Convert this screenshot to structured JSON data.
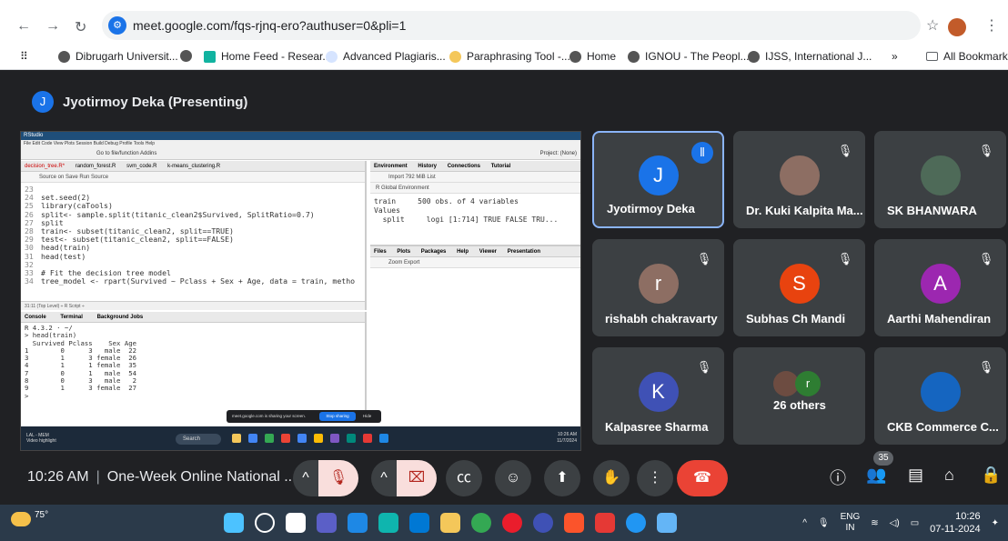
{
  "browser": {
    "url": "meet.google.com/fqs-rjnq-ero?authuser=0&pli=1",
    "bookmarks": [
      "Dibrugarh Universit...",
      "Home Feed - Resear...",
      "Advanced Plagiaris...",
      "Paraphrasing Tool -...",
      "Home",
      "IGNOU - The Peopl...",
      "IJSS, International J...",
      "All Bookmarks"
    ],
    "more": "»"
  },
  "presenter": {
    "initial": "J",
    "label": "Jyotirmoy Deka (Presenting)"
  },
  "rstudio": {
    "title": "RStudio",
    "menu": "File  Edit  Code  View  Plots  Session  Build  Debug  Profile  Tools  Help",
    "toolbar": "Go to file/function      Addins",
    "project": "Project: (None)",
    "tabs": [
      "decision_tree.R*",
      "random_forest.R",
      "svm_code.R",
      "k-means_clustering.R"
    ],
    "src_toolbar": "Source on Save          Run     Source",
    "code_lines": [
      {
        "n": "23",
        "t": ""
      },
      {
        "n": "24",
        "t": "set.seed(2)"
      },
      {
        "n": "25",
        "t": "library(caTools)"
      },
      {
        "n": "26",
        "t": "split<- sample.split(titanic_clean2$Survived, SplitRatio=0.7)"
      },
      {
        "n": "27",
        "t": "split"
      },
      {
        "n": "28",
        "t": "train<- subset(titanic_clean2, split==TRUE)"
      },
      {
        "n": "29",
        "t": "test<- subset(titanic_clean2, split==FALSE)"
      },
      {
        "n": "30",
        "t": "head(train)"
      },
      {
        "n": "31",
        "t": "head(test)"
      },
      {
        "n": "32",
        "t": ""
      },
      {
        "n": "33",
        "t": "# Fit the decision tree model"
      },
      {
        "n": "34",
        "t": "tree_model <- rpart(Survived ~ Pclass + Sex + Age, data = train, metho"
      }
    ],
    "src_status": "31:11   (Top Level) ÷                                                      R Script ÷",
    "console_tabs": [
      "Console",
      "Terminal",
      "Background Jobs"
    ],
    "console_text": "R 4.3.2 · ~/\n> head(train)\n  Survived Pclass    Sex Age\n1        0      3   male  22\n3        1      3 female  26\n4        1      1 female  35\n7        0      1   male  54\n8        0      3   male   2\n9        1      3 female  27\n>",
    "env_tabs": [
      "Environment",
      "History",
      "Connections",
      "Tutorial"
    ],
    "env_toolbar": "Import   792 MiB   List",
    "env_global": "R   Global Environment",
    "env_rows": "train     500 obs. of 4 variables\nValues\n  split     logi [1:714] TRUE FALSE TRU...",
    "files_tabs": [
      "Files",
      "Plots",
      "Packages",
      "Help",
      "Viewer",
      "Presentation"
    ],
    "files_toolbar": "Zoom   Export",
    "share_text": "meet.google.com is sharing your screen.",
    "stop_label": "Stop sharing",
    "hide_label": "Hide",
    "wt_left": "LAL - MEM\nVideo highlight",
    "wt_search": "Search",
    "wt_time": "10:26 AM\n11/7/2024"
  },
  "tiles": [
    {
      "name": "Jyotirmoy Deka",
      "initial": "J",
      "color": "#1a73e8",
      "speaking": true
    },
    {
      "name": "Dr. Kuki Kalpita Ma...",
      "photo": true,
      "muted": true
    },
    {
      "name": "SK BHANWARA",
      "photo": true,
      "muted": true
    },
    {
      "name": "rishabh chakravarty",
      "initial": "r",
      "color": "#8d6e63",
      "muted": true
    },
    {
      "name": "Subhas Ch Mandi",
      "initial": "S",
      "color": "#e8430f",
      "muted": true
    },
    {
      "name": "Aarthi Mahendiran",
      "initial": "A",
      "color": "#9c27b0",
      "muted": true
    },
    {
      "name": "Kalpasree Sharma",
      "initial": "K",
      "color": "#3f51b5",
      "muted": true
    },
    {
      "name": "26 others",
      "group": true
    },
    {
      "name": "CKB Commerce C...",
      "photo": true,
      "muted": true
    }
  ],
  "controls": {
    "time": "10:26 AM",
    "title": "One-Week Online National ...",
    "people_count": "35"
  },
  "os": {
    "weather": "75°",
    "lang1": "ENG",
    "lang2": "IN",
    "time": "10:26",
    "date": "07-11-2024"
  }
}
